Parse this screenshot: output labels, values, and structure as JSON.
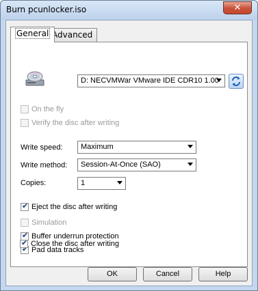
{
  "window": {
    "title": "Burn pcunlocker.iso",
    "close_glyph": "✕"
  },
  "tabs": [
    {
      "label": "General",
      "active": true
    },
    {
      "label": "Advanced",
      "active": false
    }
  ],
  "drive": {
    "icon": "cd-drive-icon",
    "selected": "D: NECVMWar VMware IDE CDR10 1.00",
    "refresh_icon": "refresh-icon"
  },
  "options_top": [
    {
      "label": "On the fly",
      "checked": false,
      "enabled": false
    },
    {
      "label": "Verify the disc after writing",
      "checked": false,
      "enabled": false
    }
  ],
  "settings": {
    "write_speed_label": "Write speed:",
    "write_speed_value": "Maximum",
    "write_method_label": "Write method:",
    "write_method_value": "Session-At-Once (SAO)",
    "copies_label": "Copies:",
    "copies_value": "1"
  },
  "options_bottom": [
    {
      "label": "Eject the disc after writing",
      "checked": true,
      "enabled": true
    },
    {
      "label": "Simulation",
      "checked": false,
      "enabled": false
    },
    {
      "label": "Buffer underrun protection",
      "checked": true,
      "enabled": true
    },
    {
      "label": "Pad data tracks",
      "checked": true,
      "enabled": true
    },
    {
      "label": "Close the disc after writing",
      "checked": true,
      "enabled": true
    }
  ],
  "buttons": {
    "ok": "OK",
    "cancel": "Cancel",
    "help": "Help"
  },
  "colors": {
    "title_bg": "#c4d7ee",
    "close_bg": "#c7513a",
    "check": "#1c3f7c"
  }
}
